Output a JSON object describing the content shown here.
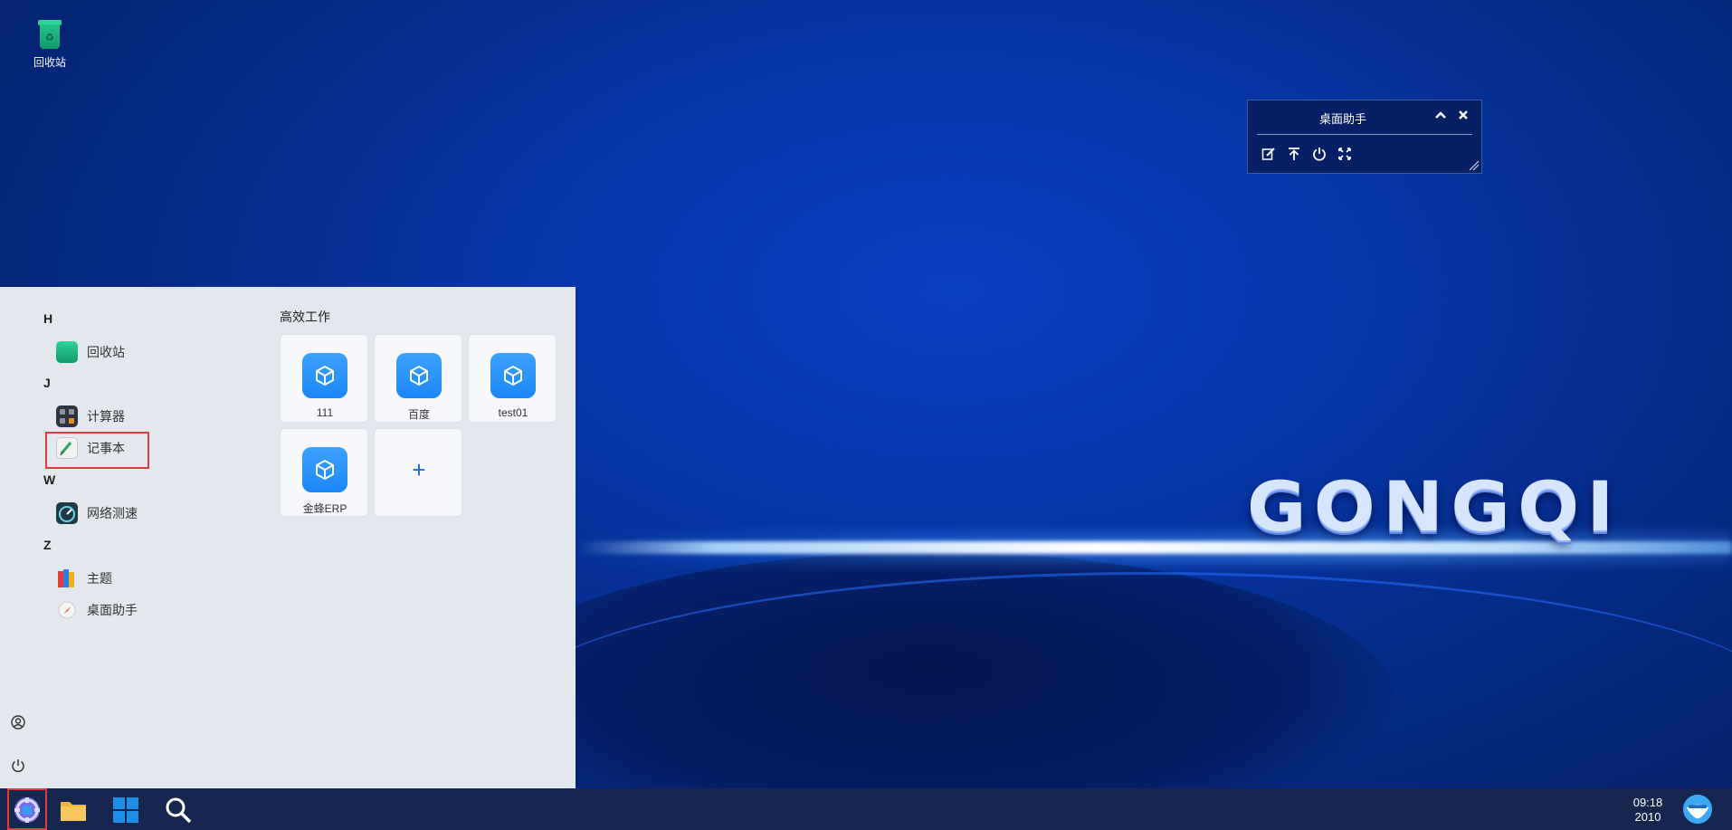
{
  "desktop": {
    "icons": [
      {
        "label": "回收站",
        "icon": "recycle-bin-icon"
      }
    ],
    "wallpaper_logo": "GONGQI"
  },
  "widget": {
    "title": "桌面助手",
    "tools": [
      "edit-icon",
      "pin-top-icon",
      "power-icon",
      "fullscreen-icon"
    ]
  },
  "start_menu": {
    "groups": [
      {
        "letter": "H",
        "apps": [
          {
            "label": "回收站",
            "icon": "recycle-bin-icon"
          }
        ]
      },
      {
        "letter": "J",
        "apps": [
          {
            "label": "计算器",
            "icon": "calculator-icon"
          },
          {
            "label": "记事本",
            "icon": "notepad-icon"
          }
        ]
      },
      {
        "letter": "W",
        "apps": [
          {
            "label": "网络测速",
            "icon": "speedometer-icon"
          }
        ]
      },
      {
        "letter": "Z",
        "apps": [
          {
            "label": "主题",
            "icon": "theme-books-icon"
          },
          {
            "label": "桌面助手",
            "icon": "compass-icon"
          }
        ]
      }
    ],
    "section_title": "高效工作",
    "tiles": [
      {
        "label": "111"
      },
      {
        "label": "百度"
      },
      {
        "label": "test01"
      },
      {
        "label": "金蜂ERP"
      }
    ],
    "add_tile": "+"
  },
  "taskbar": {
    "items": [
      "start-icon",
      "folder-icon",
      "windows-grid-icon",
      "search-icon",
      "assistant-icon"
    ],
    "clock": {
      "time": "09:18",
      "year": "2010"
    }
  },
  "colors": {
    "accent": "#1e86f5",
    "highlight": "#e23b3b",
    "taskbar": "#16264e"
  }
}
